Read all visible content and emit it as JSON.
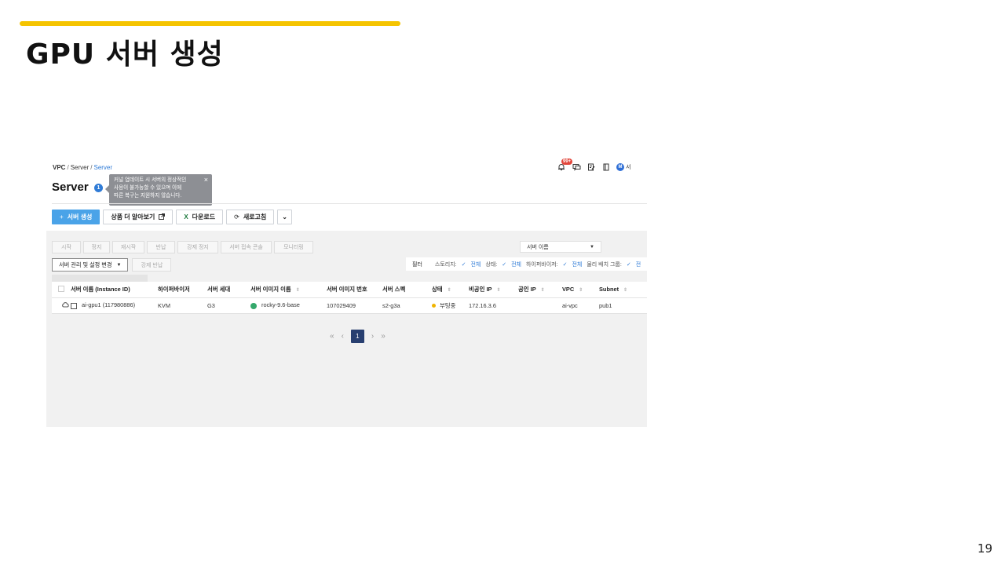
{
  "slide": {
    "title": "GPU 서버 생성",
    "page_number": "19"
  },
  "breadcrumb": [
    "VPC",
    "Server",
    "Server"
  ],
  "header_icons": {
    "notification_badge": "99+",
    "avatar_initial": "M",
    "user_label": "서"
  },
  "page": {
    "title": "Server",
    "info_count": "1"
  },
  "tooltip": {
    "lines": [
      "커널 업데이트 시 서버의 정상적인",
      "사용이 불가능할 수 있으며 이에",
      "따른 복구는 지원하지 않습니다."
    ],
    "close": "×"
  },
  "toolbar": {
    "create": "서버 생성",
    "learn_more": "상품 더 알아보기",
    "download": "다운로드",
    "refresh": "새로고침",
    "more": "⌄"
  },
  "actions": [
    "시작",
    "정지",
    "재시작",
    "반납",
    "강제 정지",
    "서버 접속 콘솔",
    "모니터링"
  ],
  "mgmt": {
    "settings": "서버 관리 및 설정 변경",
    "force_return": "강제 반납"
  },
  "search": {
    "selected": "서버 이름"
  },
  "filter": {
    "label": "필터",
    "items": [
      {
        "key": "스토리지:",
        "value": "전체"
      },
      {
        "key": "상태:",
        "value": "전체"
      },
      {
        "key": "하이퍼바이저:",
        "value": "전체"
      },
      {
        "key": "물리 배치 그룹:",
        "value": "전"
      }
    ]
  },
  "table": {
    "headers": [
      "서버 이름 (Instance ID)",
      "하이퍼바이저",
      "서버 세대",
      "서버 이미지 이름",
      "서버 이미지 번호",
      "서버 스펙",
      "상태",
      "비공인 IP",
      "공인 IP",
      "VPC",
      "Subnet"
    ],
    "rows": [
      {
        "name": "ai-gpu1 (117980886)",
        "hypervisor": "KVM",
        "generation": "G3",
        "image_name": "rocky-9.6-base",
        "image_no": "107029409",
        "spec": "s2-g3a",
        "status": "부팅중",
        "private_ip": "172.16.3.6",
        "public_ip": "",
        "vpc": "ai-vpc",
        "subnet": "pub1"
      }
    ]
  },
  "pagination": {
    "first": "«",
    "prev": "‹",
    "current": "1",
    "next": "›",
    "last": "»"
  },
  "colors": {
    "accent": "#f5c400",
    "primary_button": "#4aa3e8",
    "link": "#2f7bd6",
    "status_booting": "#f0b400",
    "pager_active": "#283f70"
  }
}
